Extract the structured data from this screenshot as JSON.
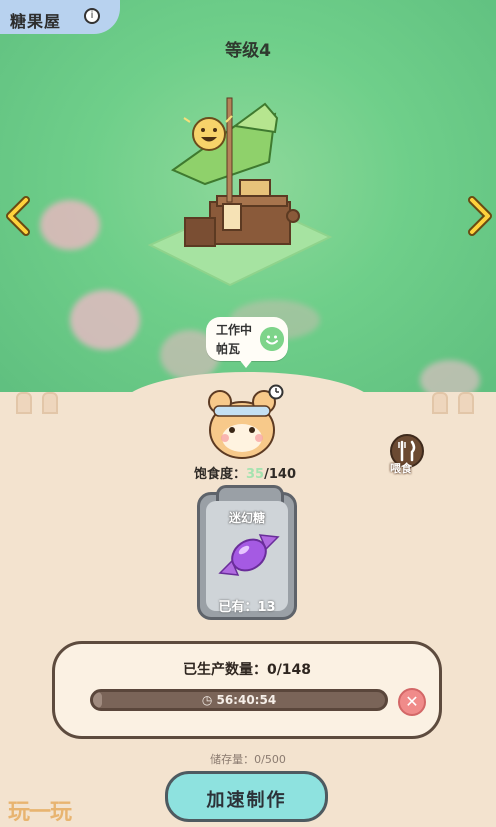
{
  "header": {
    "title": "糖果屋",
    "level": "等级4"
  },
  "worker": {
    "status": "工作中",
    "name": "帕瓦"
  },
  "pet": {
    "satiety_label": "饱食度：",
    "satiety_current": "35",
    "satiety_max": "/140",
    "feed_label": "喂食"
  },
  "item": {
    "name": "迷幻糖",
    "owned": "已有：13"
  },
  "production": {
    "produced_label": "已生产数量：0/148",
    "timer": "56:40:54",
    "progress": 0.03
  },
  "storage": {
    "label": "储存量：0/500"
  },
  "actions": {
    "speed_up": "加速制作"
  },
  "watermark": "玩一玩",
  "icons": [
    "info-icon",
    "left-arrow-icon",
    "right-arrow-icon",
    "smile-icon",
    "fork-knife-icon",
    "clock-icon",
    "candy-icon",
    "close-icon"
  ]
}
